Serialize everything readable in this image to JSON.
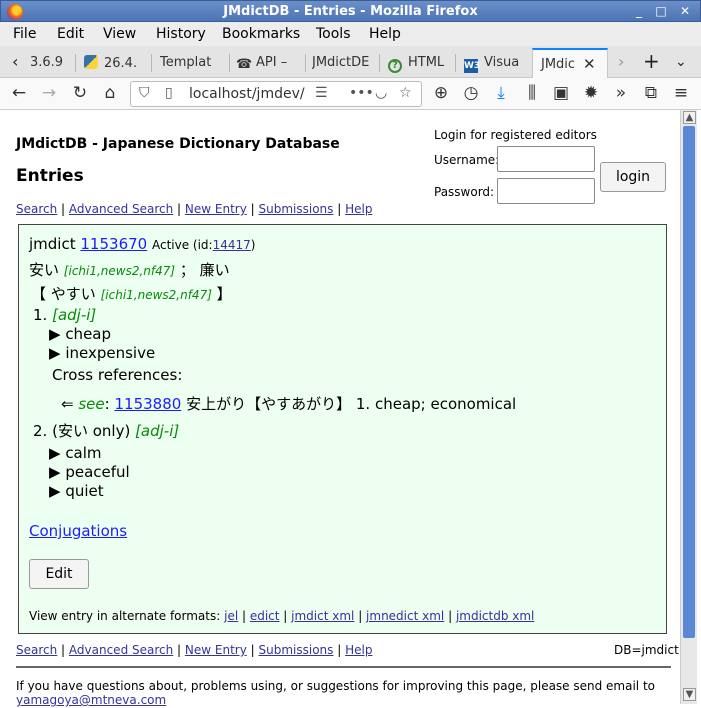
{
  "window": {
    "title": "JMdictDB - Entries - Mozilla Firefox",
    "controls": [
      "_",
      "□",
      "✕"
    ]
  },
  "menu": [
    "File",
    "Edit",
    "View",
    "History",
    "Bookmarks",
    "Tools",
    "Help"
  ],
  "tabs": [
    {
      "label": "3.6.9"
    },
    {
      "label": "26.4."
    },
    {
      "label": "Templat"
    },
    {
      "label": "API –"
    },
    {
      "label": "JMdictDE"
    },
    {
      "label": "HTML"
    },
    {
      "label": "Visua"
    },
    {
      "label": "JMdic",
      "active": true
    }
  ],
  "navbar": {
    "url": "localhost/jmdev/",
    "more": "•••"
  },
  "page": {
    "site_title": "JMdictDB - Japanese Dictionary Database",
    "heading": "Entries",
    "links": [
      "Search",
      "Advanced Search",
      "New Entry",
      "Submissions",
      "Help"
    ],
    "login": {
      "caption": "Login for registered editors",
      "username_label": "Username:",
      "password_label": "Password:",
      "button": "login"
    },
    "entry": {
      "corpus": "jmdict",
      "seq": "1153670",
      "status": "Active (id:",
      "id": "14417",
      "status_close": ")",
      "kanji1": "安い",
      "kanji1_tags": "[ichi1,news2,nf47]",
      "kanji_sep": "；",
      "kanji2": "廉い",
      "reading_open": "【",
      "reading": "やすい",
      "reading_tags": "[ichi1,news2,nf47]",
      "reading_close": "】",
      "sense1_num": "1.",
      "sense1_pos": "[adj-i]",
      "sense1_glosses": [
        "cheap",
        "inexpensive"
      ],
      "xref_heading": "Cross references:",
      "xref_arrow": "⇐",
      "xref_type": "see",
      "xref_colon": ":",
      "xref_seq": "1153880",
      "xref_kanji": "安上がり",
      "xref_reading": "【やすあがり】",
      "xref_gloss": "1. cheap; economical",
      "sense2_num": "2.",
      "sense2_restr": "(安い only)",
      "sense2_pos": "[adj-i]",
      "sense2_glosses": [
        "calm",
        "peaceful",
        "quiet"
      ],
      "conjugations": "Conjugations",
      "edit": "Edit",
      "alt_formats_label": "View entry in alternate formats:",
      "alt_formats": [
        "jel",
        "edict",
        "jmdict xml",
        "jmnedict xml",
        "jmdictdb xml"
      ]
    },
    "db": "DB=jmdict",
    "footnote_line1": "If you have questions about, problems using, or suggestions for improving this page, please send email to",
    "footnote_email": "yamagoya@mtneva.com"
  }
}
